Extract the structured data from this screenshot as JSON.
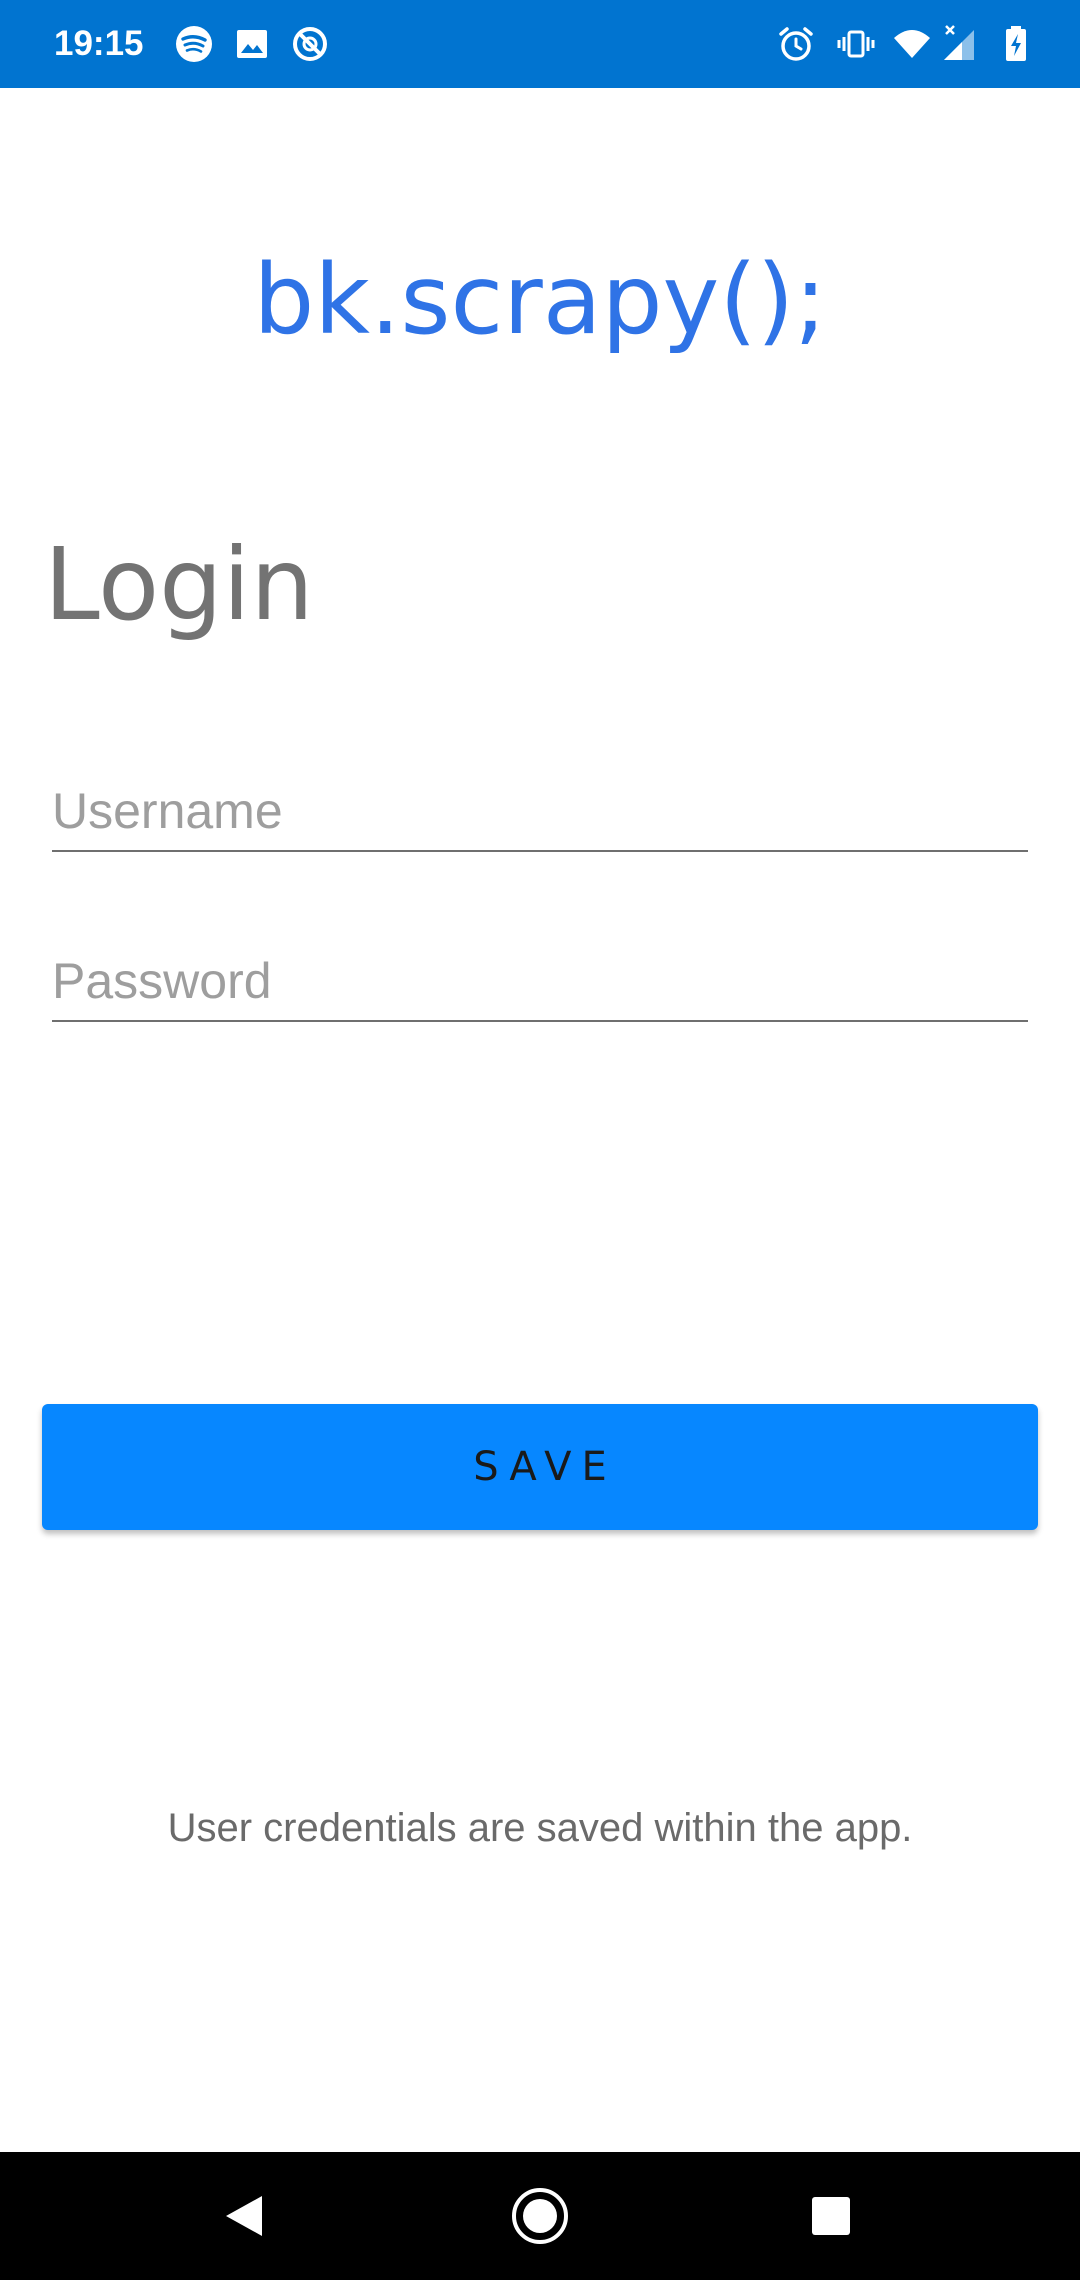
{
  "status_bar": {
    "time": "19:15",
    "background": "#0174D0",
    "left_icons": [
      "spotify-icon",
      "image-icon",
      "sync-off-icon"
    ],
    "right_icons": [
      "alarm-icon",
      "vibrate-icon",
      "wifi-icon",
      "signal-icon",
      "battery-charging-icon"
    ]
  },
  "brand": {
    "title": "bk.scrapy();",
    "color": "#2F73E6"
  },
  "login": {
    "heading": "Login",
    "username_placeholder": "Username",
    "password_placeholder": "Password",
    "username_value": "",
    "password_value": ""
  },
  "save_button": {
    "label": "SAVE",
    "background": "#0787FF"
  },
  "info": {
    "text": "User credentials are saved within the app."
  },
  "nav_bar": {
    "icons": [
      "back-icon",
      "home-icon",
      "recents-icon"
    ]
  }
}
